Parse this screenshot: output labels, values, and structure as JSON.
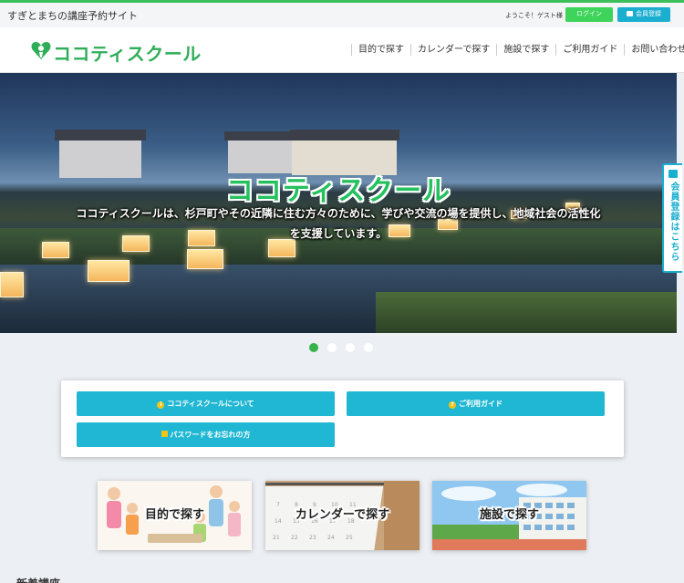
{
  "topbar": {
    "site_title": "すぎとまちの講座予約サイト",
    "welcome": "ようこそ！ゲスト様",
    "login_label": "ログイン",
    "register_label": "会員登録"
  },
  "header": {
    "logo_text": "ココティスクール",
    "nav": [
      "目的で探す",
      "カレンダーで探す",
      "施設で探す",
      "ご利用ガイド",
      "お問い合わせ"
    ]
  },
  "hero": {
    "title": "ココティスクール",
    "subtitle_line1": "ココティスクールは、杉戸町やその近隣に住む方々のために、学びや交流の場を提供し、地域社会の活性化",
    "subtitle_line2": "を支援しています。",
    "slide_count": 4,
    "active_slide": 1
  },
  "side_tab": {
    "label": "会員登録はこちら"
  },
  "panel": {
    "about_label": "ココティスクールについて",
    "guide_label": "ご利用ガイド",
    "password_label": "パスワードをお忘れの方"
  },
  "categories": {
    "purpose_label": "目的で探す",
    "calendar_label": "カレンダーで探す",
    "facility_label": "施設で探す"
  },
  "bottom": {
    "heading": "新着講座"
  },
  "colors": {
    "brand_green": "#2fae5a",
    "accent_cyan": "#1fb7d3",
    "login_green": "#3ed35a"
  }
}
